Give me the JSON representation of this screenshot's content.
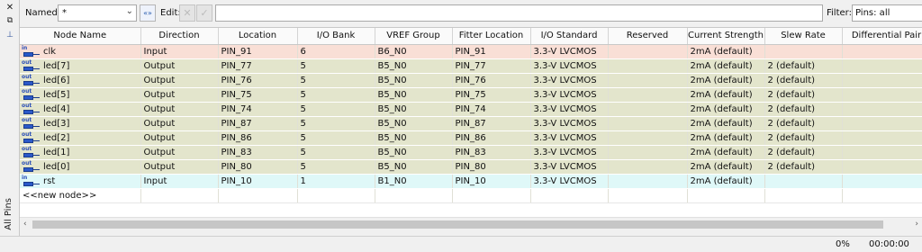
{
  "side_panel": {
    "label": "All Pins"
  },
  "toolbar": {
    "named_label": "Named:",
    "named_value": "*",
    "edit_label": "Edit:",
    "edit_value": "",
    "filter_label": "Filter:",
    "filter_value": "Pins: all"
  },
  "table": {
    "columns": [
      "Node Name",
      "Direction",
      "Location",
      "I/O Bank",
      "VREF Group",
      "Fitter Location",
      "I/O Standard",
      "Reserved",
      "Current Strength",
      "Slew Rate",
      "Differential Pair"
    ],
    "rows": [
      {
        "kind": "in",
        "tag": "in",
        "name": "clk",
        "direction": "Input",
        "location": "PIN_91",
        "bank": "6",
        "vref": "B6_N0",
        "fitter": "PIN_91",
        "iostd": "3.3-V LVCMOS",
        "reserved": "",
        "current": "2mA (default)",
        "slew": "",
        "diff": ""
      },
      {
        "kind": "out",
        "tag": "out",
        "name": "led[7]",
        "direction": "Output",
        "location": "PIN_77",
        "bank": "5",
        "vref": "B5_N0",
        "fitter": "PIN_77",
        "iostd": "3.3-V LVCMOS",
        "reserved": "",
        "current": "2mA (default)",
        "slew": "2 (default)",
        "diff": ""
      },
      {
        "kind": "out",
        "tag": "out",
        "name": "led[6]",
        "direction": "Output",
        "location": "PIN_76",
        "bank": "5",
        "vref": "B5_N0",
        "fitter": "PIN_76",
        "iostd": "3.3-V LVCMOS",
        "reserved": "",
        "current": "2mA (default)",
        "slew": "2 (default)",
        "diff": ""
      },
      {
        "kind": "out",
        "tag": "out",
        "name": "led[5]",
        "direction": "Output",
        "location": "PIN_75",
        "bank": "5",
        "vref": "B5_N0",
        "fitter": "PIN_75",
        "iostd": "3.3-V LVCMOS",
        "reserved": "",
        "current": "2mA (default)",
        "slew": "2 (default)",
        "diff": ""
      },
      {
        "kind": "out",
        "tag": "out",
        "name": "led[4]",
        "direction": "Output",
        "location": "PIN_74",
        "bank": "5",
        "vref": "B5_N0",
        "fitter": "PIN_74",
        "iostd": "3.3-V LVCMOS",
        "reserved": "",
        "current": "2mA (default)",
        "slew": "2 (default)",
        "diff": ""
      },
      {
        "kind": "out",
        "tag": "out",
        "name": "led[3]",
        "direction": "Output",
        "location": "PIN_87",
        "bank": "5",
        "vref": "B5_N0",
        "fitter": "PIN_87",
        "iostd": "3.3-V LVCMOS",
        "reserved": "",
        "current": "2mA (default)",
        "slew": "2 (default)",
        "diff": ""
      },
      {
        "kind": "out",
        "tag": "out",
        "name": "led[2]",
        "direction": "Output",
        "location": "PIN_86",
        "bank": "5",
        "vref": "B5_N0",
        "fitter": "PIN_86",
        "iostd": "3.3-V LVCMOS",
        "reserved": "",
        "current": "2mA (default)",
        "slew": "2 (default)",
        "diff": ""
      },
      {
        "kind": "out",
        "tag": "out",
        "name": "led[1]",
        "direction": "Output",
        "location": "PIN_83",
        "bank": "5",
        "vref": "B5_N0",
        "fitter": "PIN_83",
        "iostd": "3.3-V LVCMOS",
        "reserved": "",
        "current": "2mA (default)",
        "slew": "2 (default)",
        "diff": ""
      },
      {
        "kind": "out",
        "tag": "out",
        "name": "led[0]",
        "direction": "Output",
        "location": "PIN_80",
        "bank": "5",
        "vref": "B5_N0",
        "fitter": "PIN_80",
        "iostd": "3.3-V LVCMOS",
        "reserved": "",
        "current": "2mA (default)",
        "slew": "2 (default)",
        "diff": ""
      },
      {
        "kind": "in2",
        "tag": "in",
        "name": "rst",
        "direction": "Input",
        "location": "PIN_10",
        "bank": "1",
        "vref": "B1_N0",
        "fitter": "PIN_10",
        "iostd": "3.3-V LVCMOS",
        "reserved": "",
        "current": "2mA (default)",
        "slew": "",
        "diff": ""
      }
    ],
    "new_node_label": "<<new node>>"
  },
  "status": {
    "progress": "0%",
    "time": "00:00:00"
  },
  "colors": {
    "input_row": "#f9dfd6",
    "output_row": "#e3e5cc",
    "input_row_alt": "#dff8f8",
    "pin_icon": "#2a59c9"
  }
}
